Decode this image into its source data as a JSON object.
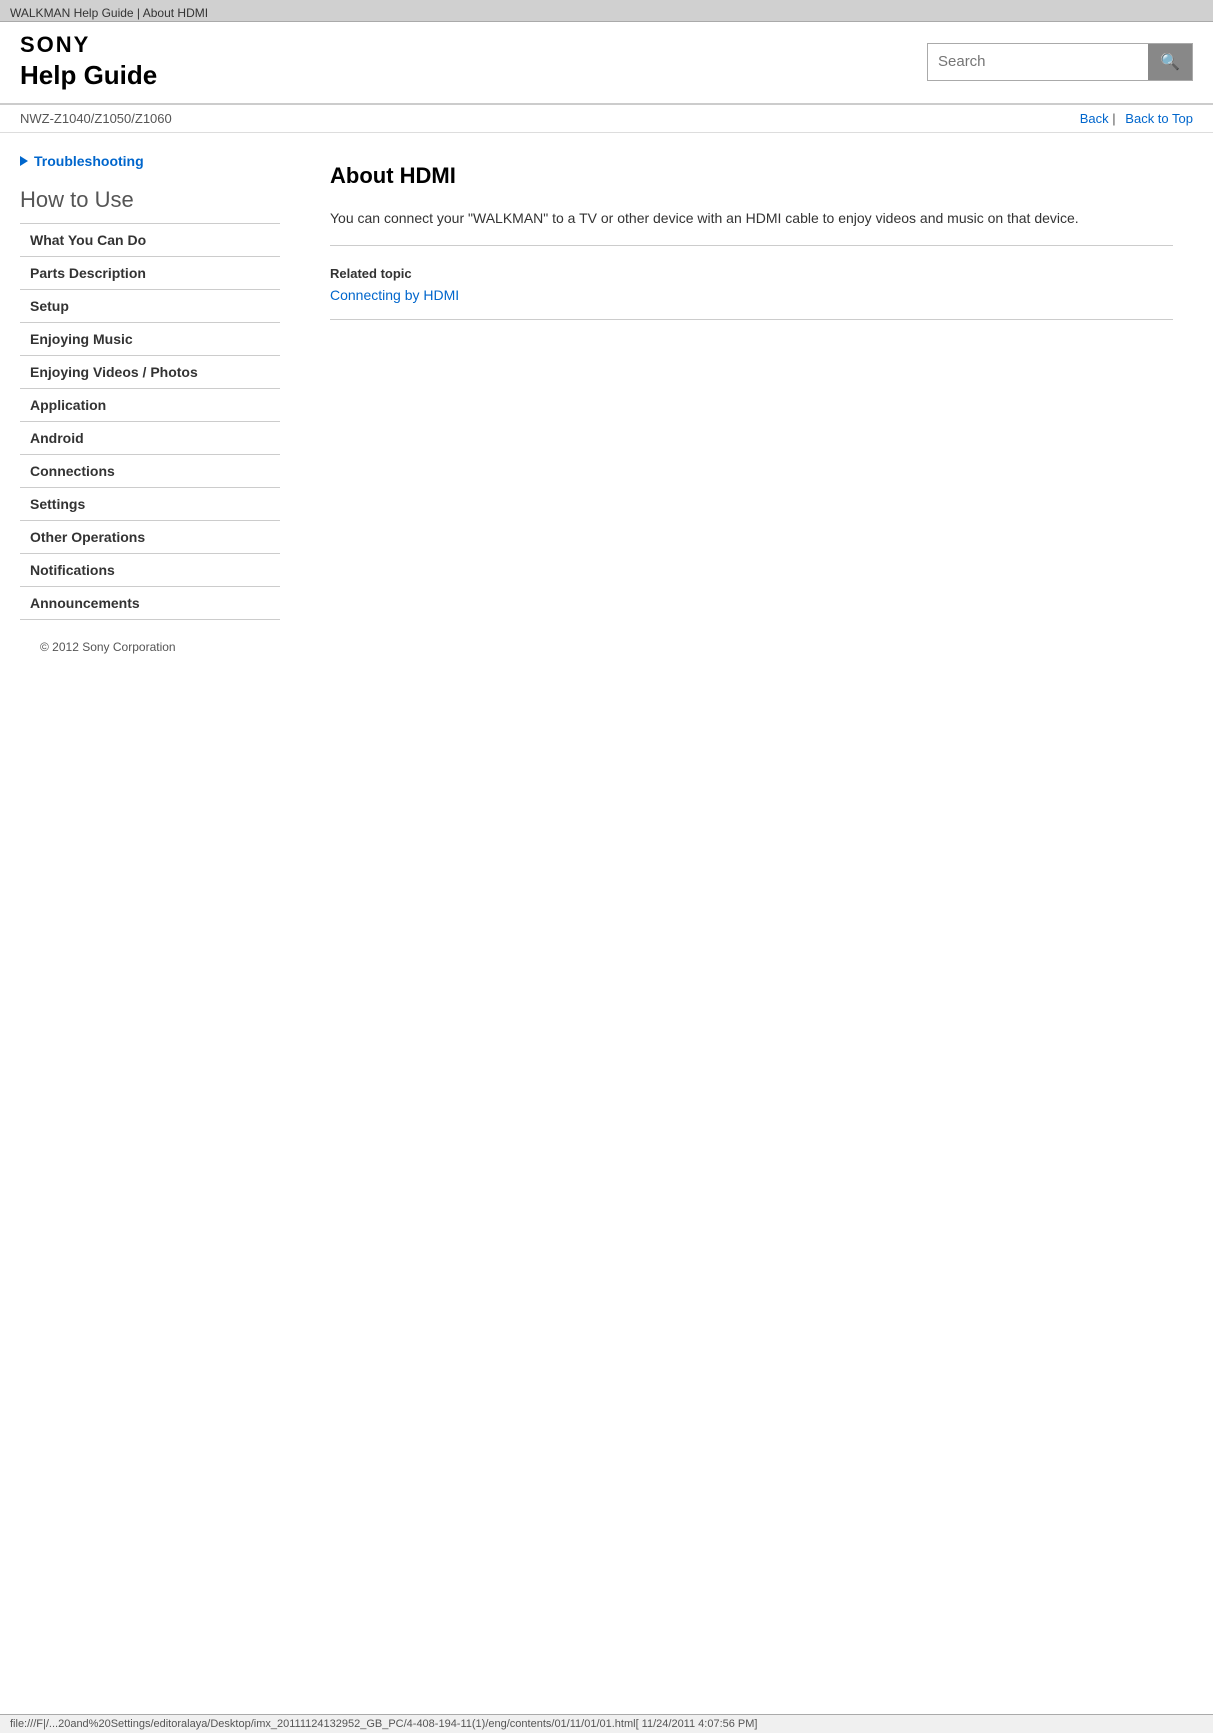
{
  "browser": {
    "tab_title": "WALKMAN Help Guide | About HDMI",
    "status_bar": "file:///F|/...20and%20Settings/editoralaya/Desktop/imx_20111124132952_GB_PC/4-408-194-11(1)/eng/contents/01/11/01/01.html[ 11/24/2011 4:07:56 PM]"
  },
  "header": {
    "sony_logo": "SONY",
    "help_guide_label": "Help Guide",
    "search_placeholder": "Search"
  },
  "nav": {
    "model": "NWZ-Z1040/Z1050/Z1060",
    "back_label": "Back",
    "back_to_top_label": "Back to Top"
  },
  "sidebar": {
    "troubleshooting_label": "Troubleshooting",
    "how_to_use_label": "How to Use",
    "items": [
      {
        "label": "What You Can Do"
      },
      {
        "label": "Parts Description"
      },
      {
        "label": "Setup"
      },
      {
        "label": "Enjoying Music"
      },
      {
        "label": "Enjoying Videos / Photos"
      },
      {
        "label": "Application"
      },
      {
        "label": "Android"
      },
      {
        "label": "Connections"
      },
      {
        "label": "Settings"
      },
      {
        "label": "Other Operations"
      },
      {
        "label": "Notifications"
      },
      {
        "label": "Announcements"
      }
    ]
  },
  "content": {
    "title": "About HDMI",
    "body": "You can connect your \"WALKMAN\" to a TV or other device with an HDMI cable to enjoy videos and music on that device.",
    "related_topic_label": "Related topic",
    "related_topic_link_text": "Connecting by HDMI"
  },
  "footer": {
    "copyright": "© 2012 Sony Corporation"
  },
  "icons": {
    "search": "🔍",
    "chevron": "❯"
  }
}
